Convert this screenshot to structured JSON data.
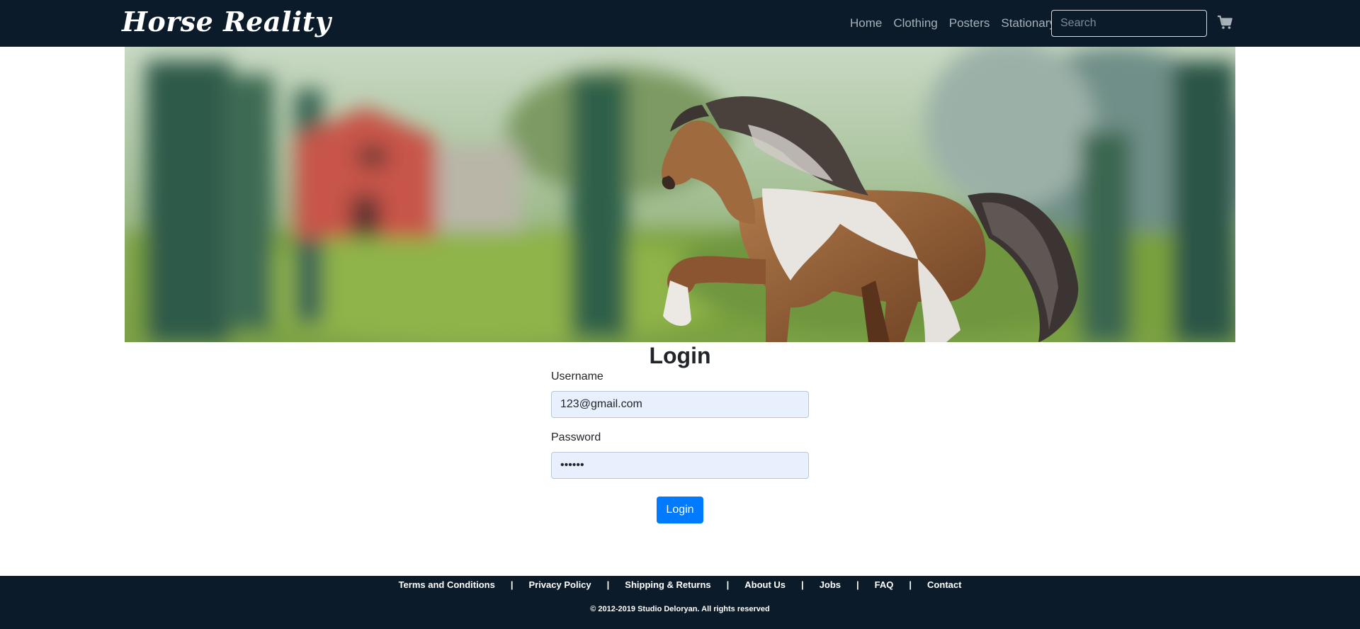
{
  "navbar": {
    "brand": "Horse Reality",
    "links": [
      "Home",
      "Clothing",
      "Posters",
      "Stationary"
    ],
    "search_placeholder": "Search",
    "cart_icon": "shopping-cart-icon"
  },
  "login": {
    "title": "Login",
    "username_label": "Username",
    "username_value": "123@gmail.com",
    "password_label": "Password",
    "password_value": "••••••",
    "button_label": "Login"
  },
  "footer": {
    "links": [
      "Terms and Conditions",
      "Privacy Policy",
      "Shipping & Returns",
      "About Us",
      "Jobs",
      "FAQ",
      "Contact"
    ],
    "copyright": "© 2012-2019 Studio Deloryan. All rights reserved"
  },
  "colors": {
    "navbar_bg": "#0b1b29",
    "button_primary": "#007bff",
    "input_autofill_bg": "#e8f0fe"
  }
}
